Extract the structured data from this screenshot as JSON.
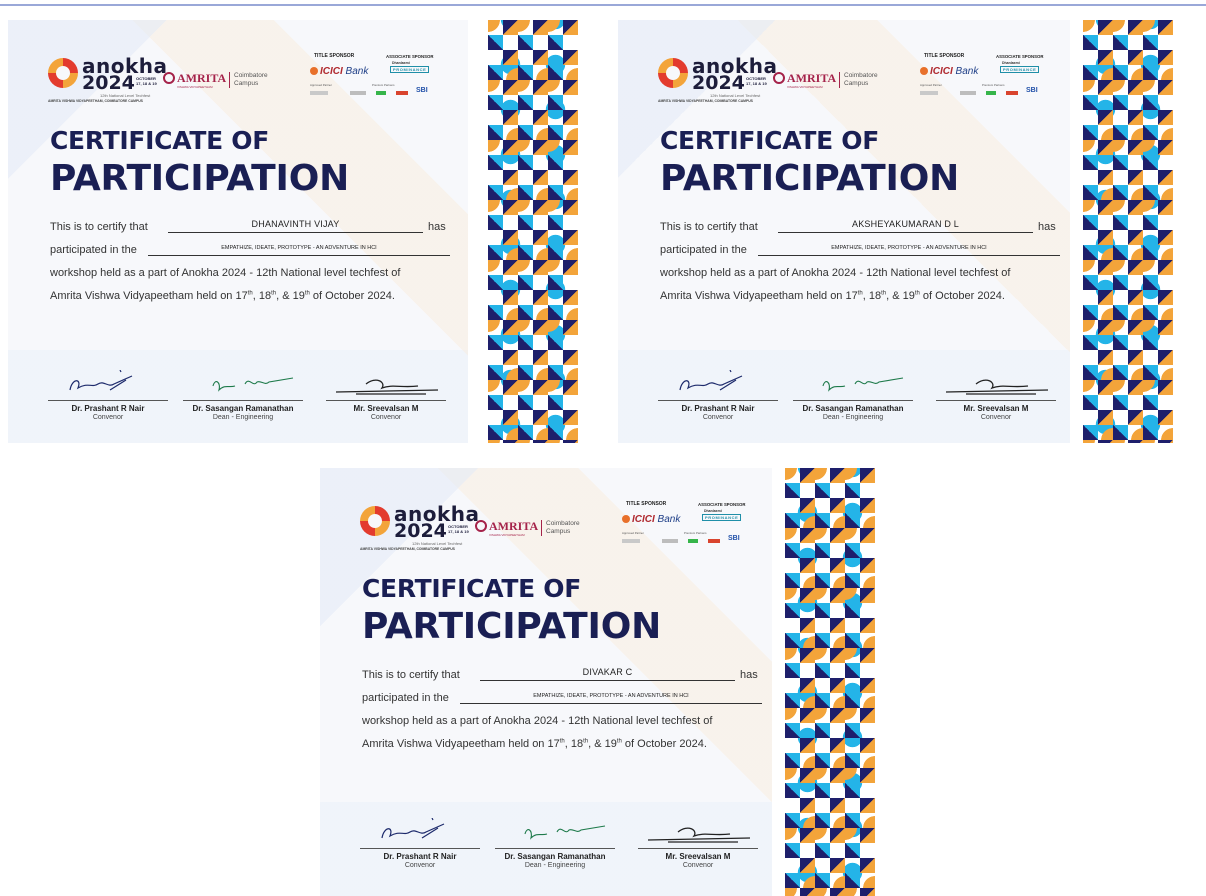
{
  "texts": {
    "title_line1": "CERTIFICATE OF",
    "title_line2": "PARTICIPATION",
    "certify": "This is to certify that",
    "has": "has",
    "participated": "participated in the",
    "workshop_name": "EMPATHIZE, IDEATE, PROTOTYPE - AN ADVENTURE IN HCI",
    "held_line": "workshop held as a part of Anokha 2024 - 12th National level techfest of",
    "dates_prefix": "Amrita Vishwa Vidyapeetham held on 17",
    "d1": "th",
    "d2": "th",
    "d3": "th",
    "dates_mid1": ", 18",
    "dates_mid2": ", & 19",
    "dates_suffix": " of October 2024."
  },
  "branding": {
    "anokha_word": "anokha",
    "anokha_year": "2024",
    "anokha_month": "OCTOBER 17, 18 & 19",
    "anokha_sub": "12th National Level Techfest",
    "anokha_campus": "AMRITA VISHWA VIDYAPEETHAM, COIMBATORE CAMPUS",
    "amrita_word": "AMRITA",
    "amrita_tag": "VISHWA VIDYAPEETHAM",
    "amrita_campus": "Coimbatore Campus",
    "title_sponsor": "TITLE SPONSOR",
    "icici": "ICICI",
    "bank": " Bank",
    "assoc_sponsor": "ASSOCIATE SPONSOR",
    "dhan": "Dhanlaxmi",
    "prominance": "PROMINANCE",
    "approved": "Approved Partner",
    "partners": "Premium Partners",
    "sbi": "SBI"
  },
  "signatories": [
    {
      "name": "Dr. Prashant R Nair",
      "role": "Convenor"
    },
    {
      "name": "Dr. Sasangan Ramanathan",
      "role": "Dean - Engineering"
    },
    {
      "name": "Mr. Sreevalsan M",
      "role": "Convenor"
    }
  ],
  "certificates": [
    {
      "participant": "DHANAVINTH VIJAY"
    },
    {
      "participant": "AKSHEYAKUMARAN D L"
    },
    {
      "participant": "DIVAKAR C"
    }
  ],
  "colors": {
    "navy": "#1a1f54",
    "orange": "#f3a43a",
    "cyan": "#24b4e8",
    "amrita": "#a5234a"
  }
}
